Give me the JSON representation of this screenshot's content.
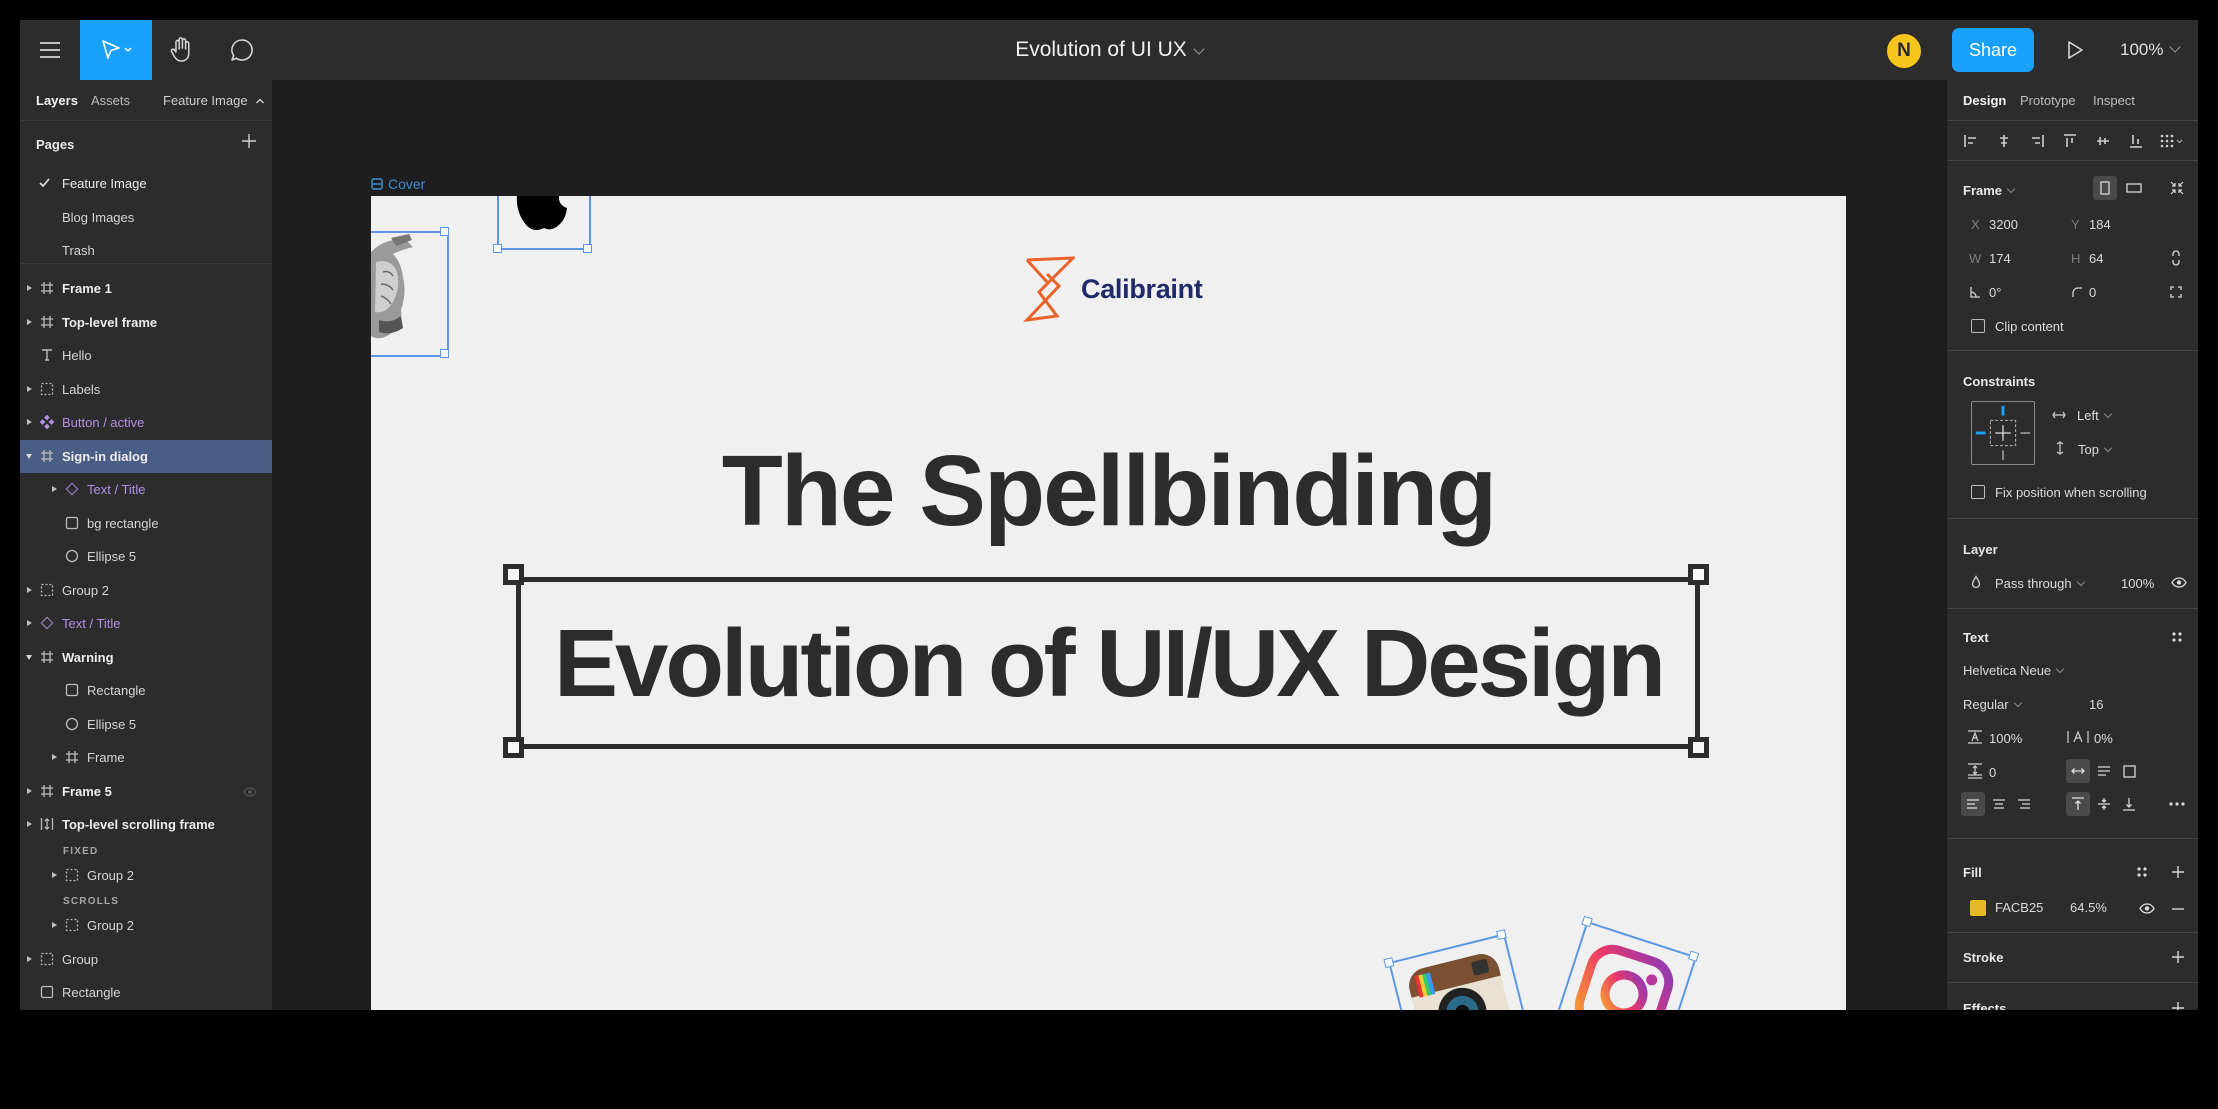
{
  "toolbar": {
    "menu_icon": "hamburger-menu-icon",
    "tools": [
      {
        "name": "move-tool",
        "icon": "cursor-arrow-icon",
        "active": true
      },
      {
        "name": "hand-tool",
        "icon": "hand-icon",
        "active": false
      },
      {
        "name": "comment-tool",
        "icon": "comment-bubble-icon",
        "active": false
      }
    ],
    "document_title": "Evolution of UI UX",
    "avatar_initial": "N",
    "share_label": "Share",
    "zoom_level": "100%",
    "accent_color": "#18a0fb"
  },
  "left_panel": {
    "tabs": [
      "Layers",
      "Assets"
    ],
    "active_tab": "Layers",
    "current_page_dropdown": "Feature Image",
    "pages_header": "Pages",
    "pages": [
      {
        "label": "Feature Image",
        "current": true
      },
      {
        "label": "Blog Images",
        "current": false
      },
      {
        "label": "Trash",
        "current": false
      }
    ],
    "layers": [
      {
        "label": "Frame 1",
        "icon": "frame",
        "depth": 0,
        "expanded": false,
        "has_children": true,
        "style": "bold"
      },
      {
        "label": "Top-level frame",
        "icon": "frame",
        "depth": 0,
        "expanded": false,
        "has_children": true,
        "style": "bold"
      },
      {
        "label": "Hello",
        "icon": "text",
        "depth": 0,
        "has_children": false,
        "style": "normal"
      },
      {
        "label": "Labels",
        "icon": "group",
        "depth": 0,
        "expanded": false,
        "has_children": true,
        "style": "normal"
      },
      {
        "label": "Button / active",
        "icon": "component",
        "depth": 0,
        "expanded": false,
        "has_children": true,
        "style": "component"
      },
      {
        "label": "Sign-in dialog",
        "icon": "frame",
        "depth": 0,
        "expanded": true,
        "has_children": true,
        "style": "bold",
        "selected": true
      },
      {
        "label": "Text / Title",
        "icon": "instance",
        "depth": 1,
        "expanded": false,
        "has_children": true,
        "style": "component"
      },
      {
        "label": "bg rectangle",
        "icon": "rectangle",
        "depth": 1,
        "has_children": false,
        "style": "normal"
      },
      {
        "label": "Ellipse 5",
        "icon": "ellipse",
        "depth": 1,
        "has_children": false,
        "style": "normal"
      },
      {
        "label": "Group 2",
        "icon": "group",
        "depth": 0,
        "expanded": false,
        "has_children": true,
        "style": "normal"
      },
      {
        "label": "Text / Title",
        "icon": "instance",
        "depth": 0,
        "expanded": false,
        "has_children": true,
        "style": "component"
      },
      {
        "label": "Warning",
        "icon": "frame",
        "depth": 0,
        "expanded": true,
        "has_children": true,
        "style": "bold"
      },
      {
        "label": "Rectangle",
        "icon": "rectangle",
        "depth": 1,
        "has_children": false,
        "style": "normal"
      },
      {
        "label": "Ellipse 5",
        "icon": "ellipse",
        "depth": 1,
        "has_children": false,
        "style": "normal"
      },
      {
        "label": "Frame",
        "icon": "frame",
        "depth": 1,
        "expanded": false,
        "has_children": true,
        "style": "normal"
      },
      {
        "label": "Frame 5",
        "icon": "frame",
        "depth": 0,
        "expanded": false,
        "has_children": true,
        "style": "bold",
        "hover_icon": "eye-icon"
      },
      {
        "label": "Top-level scrolling frame",
        "icon": "scroll-frame",
        "depth": 0,
        "expanded": false,
        "has_children": true,
        "style": "bold"
      },
      {
        "section": "FIXED"
      },
      {
        "label": "Group 2",
        "icon": "group",
        "depth": 1,
        "expanded": false,
        "has_children": true,
        "style": "normal"
      },
      {
        "section": "SCROLLS"
      },
      {
        "label": "Group 2",
        "icon": "group",
        "depth": 1,
        "expanded": false,
        "has_children": true,
        "style": "normal"
      },
      {
        "label": "Group",
        "icon": "group",
        "depth": 0,
        "expanded": false,
        "has_children": true,
        "style": "normal"
      },
      {
        "label": "Rectangle",
        "icon": "rectangle",
        "depth": 0,
        "has_children": false,
        "style": "normal"
      }
    ]
  },
  "canvas": {
    "frame_label": "Cover",
    "brand_name": "Calibraint",
    "headline_line1": "The Spellbinding",
    "headline_line2": "Evolution of UI/UX Design",
    "images": [
      "vintage-engraving-image",
      "apple-logo-image",
      "instagram-old-logo-image",
      "instagram-new-logo-image"
    ],
    "brand_color": "#1f2a6b",
    "logo_accent_color": "#e8622a",
    "selection_color": "#5a97e6"
  },
  "right_panel": {
    "tabs": [
      "Design",
      "Prototype",
      "Inspect"
    ],
    "active_tab": "Design",
    "frame": {
      "title": "Frame",
      "x_label": "X",
      "x": "3200",
      "y_label": "Y",
      "y": "184",
      "w_label": "W",
      "w": "174",
      "h_label": "H",
      "h": "64",
      "rotation": "0°",
      "radius": "0",
      "clip_content_label": "Clip content",
      "clip_content": false
    },
    "constraints": {
      "title": "Constraints",
      "horizontal": "Left",
      "vertical": "Top",
      "fix_position_label": "Fix position when scrolling",
      "fix_position": false
    },
    "layer": {
      "title": "Layer",
      "blend_mode": "Pass through",
      "opacity": "100%"
    },
    "text": {
      "title": "Text",
      "font_family": "Helvetica Neue",
      "font_weight": "Regular",
      "font_size": "16",
      "line_height": "100%",
      "letter_spacing": "0%",
      "paragraph_spacing": "0",
      "auto_resize": "width",
      "align_horizontal": "left",
      "align_vertical": "top"
    },
    "fill": {
      "title": "Fill",
      "hex": "FACB25",
      "color": "#FACB25",
      "opacity": "64.5%"
    },
    "stroke": {
      "title": "Stroke"
    },
    "effects": {
      "title": "Effects"
    }
  }
}
